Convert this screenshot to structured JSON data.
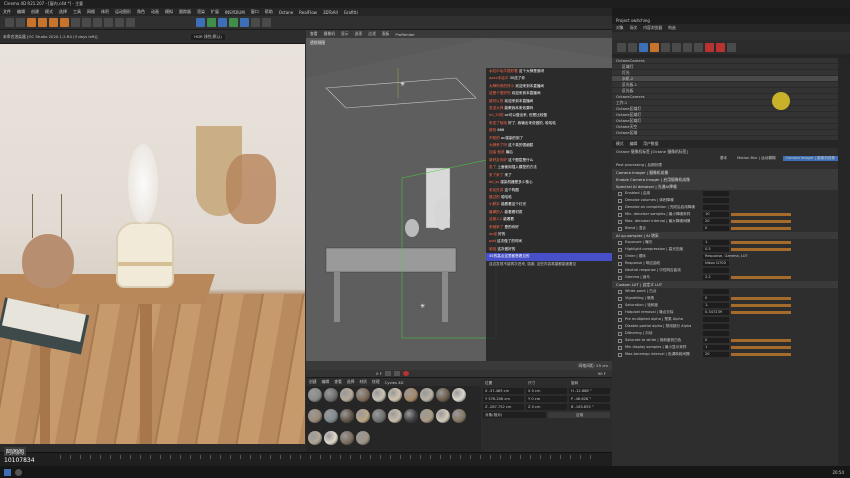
{
  "window": {
    "title": "Cinema 4D R21.207 - [窗内.c4d *] - 主要",
    "render_view_title": "未命名渲染器 [OC Studio 2020.1.2-R4 (3 days left)]",
    "render_format": "HDR 线性(默认)"
  },
  "menubar": {
    "items": [
      "文件",
      "编辑",
      "创建",
      "模式",
      "选择",
      "工具",
      "网格",
      "体积",
      "运动图形",
      "角色",
      "动画",
      "模拟",
      "跟踪器",
      "渲染",
      "扩展",
      "INSYDIUM",
      "窗口",
      "帮助",
      "Octane",
      "RealFlow",
      "3DToAll",
      "Grafitti"
    ]
  },
  "viewport": {
    "menu": [
      "查看",
      "摄像机",
      "显示",
      "选项",
      "过滤",
      "面板",
      "ProRender"
    ],
    "label": "透视视图",
    "stat": "网格间距: 25 cm"
  },
  "chat": {
    "messages": [
      {
        "user": "水缸中毛牛很好看",
        "msg": "这个大神是谁呀"
      },
      {
        "user": "aaxx手绘中",
        "msg": "30送了你"
      },
      {
        "user": "大神你来的好小",
        "msg": "欢迎来到本直播间"
      },
      {
        "user": "这是个很好的",
        "msg": "欢迎来到本直播间"
      },
      {
        "user": "超可以的",
        "msg": "欢迎来到本直播间"
      },
      {
        "user": "发送大神",
        "msg": "能教我本条效果吗"
      },
      {
        "user": "ml_33的",
        "msg": "oc可以做出来, 但是比较慢"
      },
      {
        "user": "来发了哈哈",
        "msg": "好了, 我输出来说做的, 哈哈哈"
      },
      {
        "user": "新的",
        "msg": "666"
      },
      {
        "user": "不知的",
        "msg": "oc渲染的到了"
      },
      {
        "user": "大神来了吗",
        "msg": "这个真的很细腻"
      },
      {
        "user": "加油 就说",
        "msg": "最后"
      },
      {
        "user": "新好友你好",
        "msg": "这个图层是什么"
      },
      {
        "user": "发了",
        "msg": "上面使用插入模型的方法"
      },
      {
        "user": "来了来了",
        "msg": "来了"
      },
      {
        "user": "dd_ss",
        "msg": "渲染机器是多少核心"
      },
      {
        "user": "老实在讲",
        "msg": "这个构图"
      },
      {
        "user": "路过的",
        "msg": "哈哈哈"
      },
      {
        "user": "小胖手",
        "msg": "能看看这个灯光"
      },
      {
        "user": "最棒的人",
        "msg": "能看看材质"
      },
      {
        "user": "这家人2",
        "msg": "能看看"
      },
      {
        "user": "来就来了",
        "msg": "是的你好"
      },
      {
        "user": "ao设",
        "msg": "好的"
      },
      {
        "user": "pdd",
        "msg": "这次做了的时间"
      },
      {
        "user": "哈哈",
        "msg": "这次做好的"
      },
      {
        "user": "",
        "msg": "45的高点这里都是看见的",
        "hl": true
      }
    ],
    "footer": "这边发现不能再次进来, 感谢, 这些内容希望都能被看见"
  },
  "timeline": {
    "frame": "0 F",
    "end": "90 F"
  },
  "materials": {
    "tabs": [
      "创建",
      "编辑",
      "查看",
      "选择",
      "材质",
      "纹理",
      "Cycles 4D"
    ],
    "colors": [
      "#8a8a8a",
      "#6f6f6f",
      "#b5a897",
      "#7d6a57",
      "#c9c2b4",
      "#cfc3ad",
      "#a58865",
      "#b8b0a3",
      "#6c5d4d",
      "#dcd6cc",
      "#9a8a76",
      "#808a8e",
      "#5f5346",
      "#bba585",
      "#707070",
      "#c7bca9",
      "#3f3f3f",
      "#a99a83",
      "#d2cab8",
      "#867764",
      "#b0a694",
      "#e0d8cb",
      "#7a6c5d",
      "#9d9384"
    ]
  },
  "coords": {
    "headers": [
      "位置",
      "尺寸",
      "旋转"
    ],
    "rows": [
      [
        "X  -37.489 cm",
        "X  0 cm",
        "H  -12.686 °"
      ],
      [
        "Y  576.206 cm",
        "Y  0 cm",
        "P  -46.628 °"
      ],
      [
        "Z  -287.752 cm",
        "Z  0 cm",
        "B  -163.855 °"
      ]
    ],
    "mode": "对象(相对)",
    "apply": "应用"
  },
  "right_panel": {
    "title": "Project switching",
    "tabs": [
      "对象",
      "场次",
      "内容浏览器",
      "构造"
    ],
    "objects": [
      "OctaneCamera",
      "区域灯",
      "灯光",
      "水机.2",
      "反光板.1",
      "反光板",
      "OctaneCamera",
      "工作.1",
      "Octane区域灯",
      "Octane区域灯",
      "Octane区域灯",
      "Octane天空",
      "Octane区域"
    ],
    "attr_tabs": [
      "模式",
      "编辑",
      "用户数据"
    ],
    "attr_title": "Octane 摄像机标签 [Octane 摄像机标签]",
    "attr_subtabs": [
      "基本",
      "Motion Blur | 运动模糊",
      "Camera Imager | 摄像机成像"
    ],
    "post": "Post processing | 后期处理",
    "sections": [
      {
        "title": "Camera Imager | 摄像机成像"
      },
      {
        "title": "Enable Camera Imager | 启用摄像机成像"
      },
      {
        "title": "Spectral AI denoiser | 光谱AI降噪"
      },
      {
        "title": "AI up-sampler | AI 增采"
      },
      {
        "title": "Custom LUT | 自定义 LUT"
      }
    ],
    "rows": [
      {
        "label": "Enabled | 启用",
        "value": ""
      },
      {
        "label": "Denoise volumes | 体积降噪",
        "value": ""
      },
      {
        "label": "Denoise on completion | 完成后启用降噪",
        "value": ""
      },
      {
        "label": "Min. denoiser samples | 最小降噪采样",
        "value": "10"
      },
      {
        "label": "Max. denoiser interval | 最大降噪间隔",
        "value": "20"
      },
      {
        "label": "Blend | 混合",
        "value": "0"
      },
      {
        "label": "Exposure | 曝光",
        "value": "1."
      },
      {
        "label": "Highlight compression | 高光压缩",
        "value": "0.5"
      },
      {
        "label": "Order | 顺序",
        "value": "Response, Gamma, LUT"
      },
      {
        "label": "Response | 响应曲线",
        "value": "Nikon D700"
      },
      {
        "label": "Neutral response | 中性响应曲线",
        "value": ""
      },
      {
        "label": "Gamma | 伽马",
        "value": "2.2"
      },
      {
        "label": "White point | 白点",
        "value": ""
      },
      {
        "label": "Vignetting | 暗角",
        "value": "0"
      },
      {
        "label": "Saturation | 饱和度",
        "value": "1."
      },
      {
        "label": "Hotpixel removal | 噪点去除",
        "value": "0.347239"
      },
      {
        "label": "Pre multiplied alpha | 预乘 Alpha",
        "value": ""
      },
      {
        "label": "Disable partial alpha | 禁用部分 Alpha",
        "value": ""
      },
      {
        "label": "Dithering | 抖动",
        "value": ""
      },
      {
        "label": "Saturate to white | 饱和度到白色",
        "value": "0"
      },
      {
        "label": "Min display samples | 最小显示采样",
        "value": "1"
      },
      {
        "label": "Max.tonemap interval | 色调映射间隔",
        "value": "20"
      }
    ]
  },
  "bottom": {
    "watermark": "阿闹闹",
    "id": "10107834"
  },
  "taskbar": {
    "time": "20:54"
  }
}
